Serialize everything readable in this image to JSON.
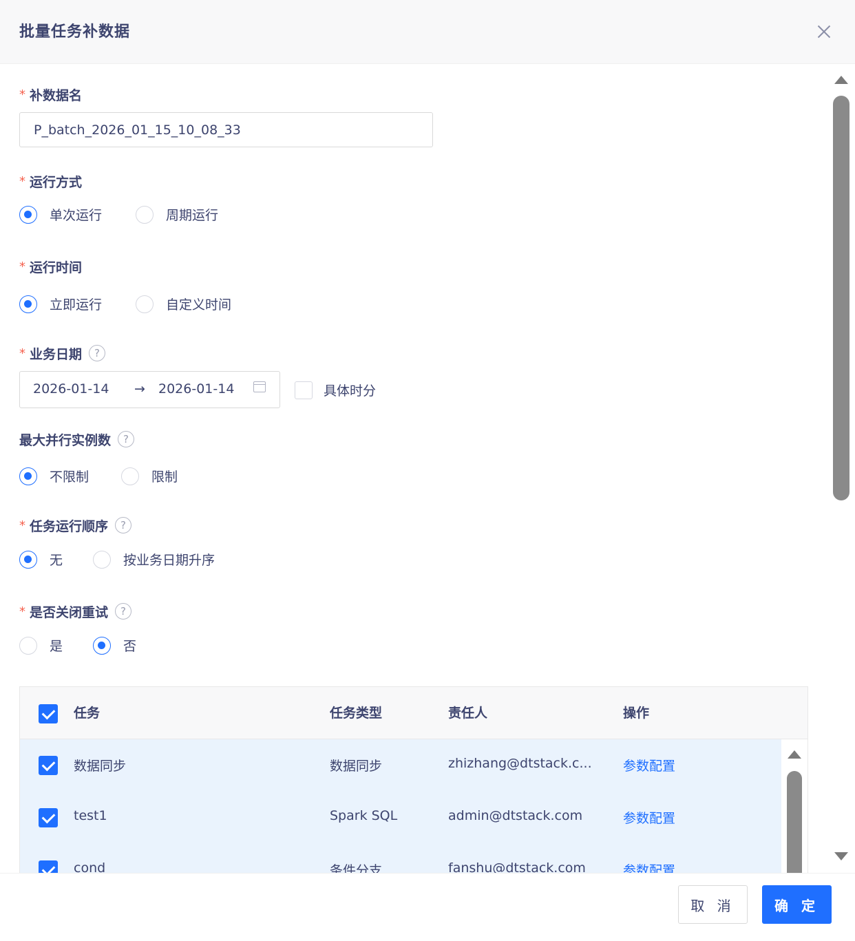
{
  "dialog": {
    "title": "批量任务补数据"
  },
  "form": {
    "name": {
      "label": "补数据名",
      "value": "P_batch_2026_01_15_10_08_33"
    },
    "run_mode": {
      "label": "运行方式",
      "options": [
        "单次运行",
        "周期运行"
      ],
      "selected": "单次运行"
    },
    "run_time": {
      "label": "运行时间",
      "options": [
        "立即运行",
        "自定义时间"
      ],
      "selected": "立即运行"
    },
    "biz_date": {
      "label": "业务日期",
      "start": "2026-01-14",
      "end": "2026-01-14",
      "detail_label": "具体时分",
      "detail_checked": false
    },
    "max_parallel": {
      "label": "最大并行实例数",
      "options": [
        "不限制",
        "限制"
      ],
      "selected": "不限制"
    },
    "order": {
      "label": "任务运行顺序",
      "options": [
        "无",
        "按业务日期升序"
      ],
      "selected": "无"
    },
    "retry": {
      "label": "是否关闭重试",
      "options": [
        "是",
        "否"
      ],
      "selected": "否"
    }
  },
  "table": {
    "headers": [
      "任务",
      "任务类型",
      "责任人",
      "操作"
    ],
    "rows": [
      {
        "task": "数据同步",
        "type": "数据同步",
        "owner": "zhizhang@dtstack.c...",
        "action": "参数配置",
        "checked": true
      },
      {
        "task": "test1",
        "type": "Spark SQL",
        "owner": "admin@dtstack.com",
        "action": "参数配置",
        "checked": true
      },
      {
        "task": "cond",
        "type": "条件分支",
        "owner": "fanshu@dtstack.com",
        "action": "参数配置",
        "checked": true
      }
    ]
  },
  "footer": {
    "cancel": "取 消",
    "ok": "确 定"
  },
  "icons": {
    "close": "close-icon",
    "help": "question-circle-icon",
    "calendar": "calendar-icon",
    "arrow": "arrow-right-icon"
  },
  "colors": {
    "primary": "#1f6fff",
    "required": "#f5614e",
    "text": "#3d446e",
    "row_selected": "#eaf3fd"
  }
}
